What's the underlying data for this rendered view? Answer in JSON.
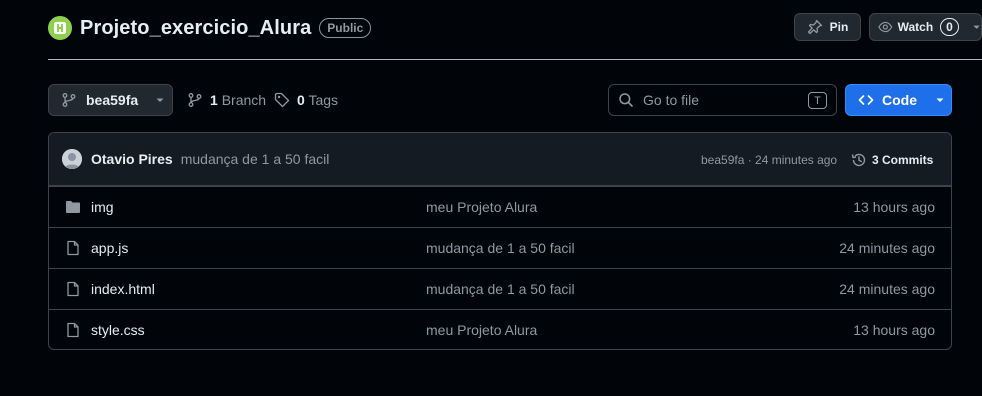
{
  "repo": {
    "name": "Projeto_exercicio_Alura",
    "visibility": "Public"
  },
  "actions": {
    "pin_label": "Pin",
    "watch_label": "Watch",
    "watch_count": "0"
  },
  "toolbar": {
    "branch": "bea59fa",
    "branch_count": "1",
    "branch_label": "Branch",
    "tag_count": "0",
    "tag_label": "Tags",
    "search_placeholder": "Go to file",
    "search_shortcut": "T",
    "code_label": "Code"
  },
  "latest_commit": {
    "author": "Otavio Pires",
    "message": "mudança de 1 a 50 facil",
    "hash_time": "bea59fa · 24 minutes ago",
    "commits_label": "3 Commits"
  },
  "files": [
    {
      "name": "img",
      "type": "folder",
      "message": "meu Projeto Alura",
      "time": "13 hours ago"
    },
    {
      "name": "app.js",
      "type": "file",
      "message": "mudança de 1 a 50 facil",
      "time": "24 minutes ago"
    },
    {
      "name": "index.html",
      "type": "file",
      "message": "mudança de 1 a 50 facil",
      "time": "24 minutes ago"
    },
    {
      "name": "style.css",
      "type": "file",
      "message": "meu Projeto Alura",
      "time": "13 hours ago"
    }
  ],
  "colors": {
    "background": "#010409",
    "accent": "#1f6feb",
    "border": "#3d444d",
    "muted_text": "#9198a1"
  }
}
